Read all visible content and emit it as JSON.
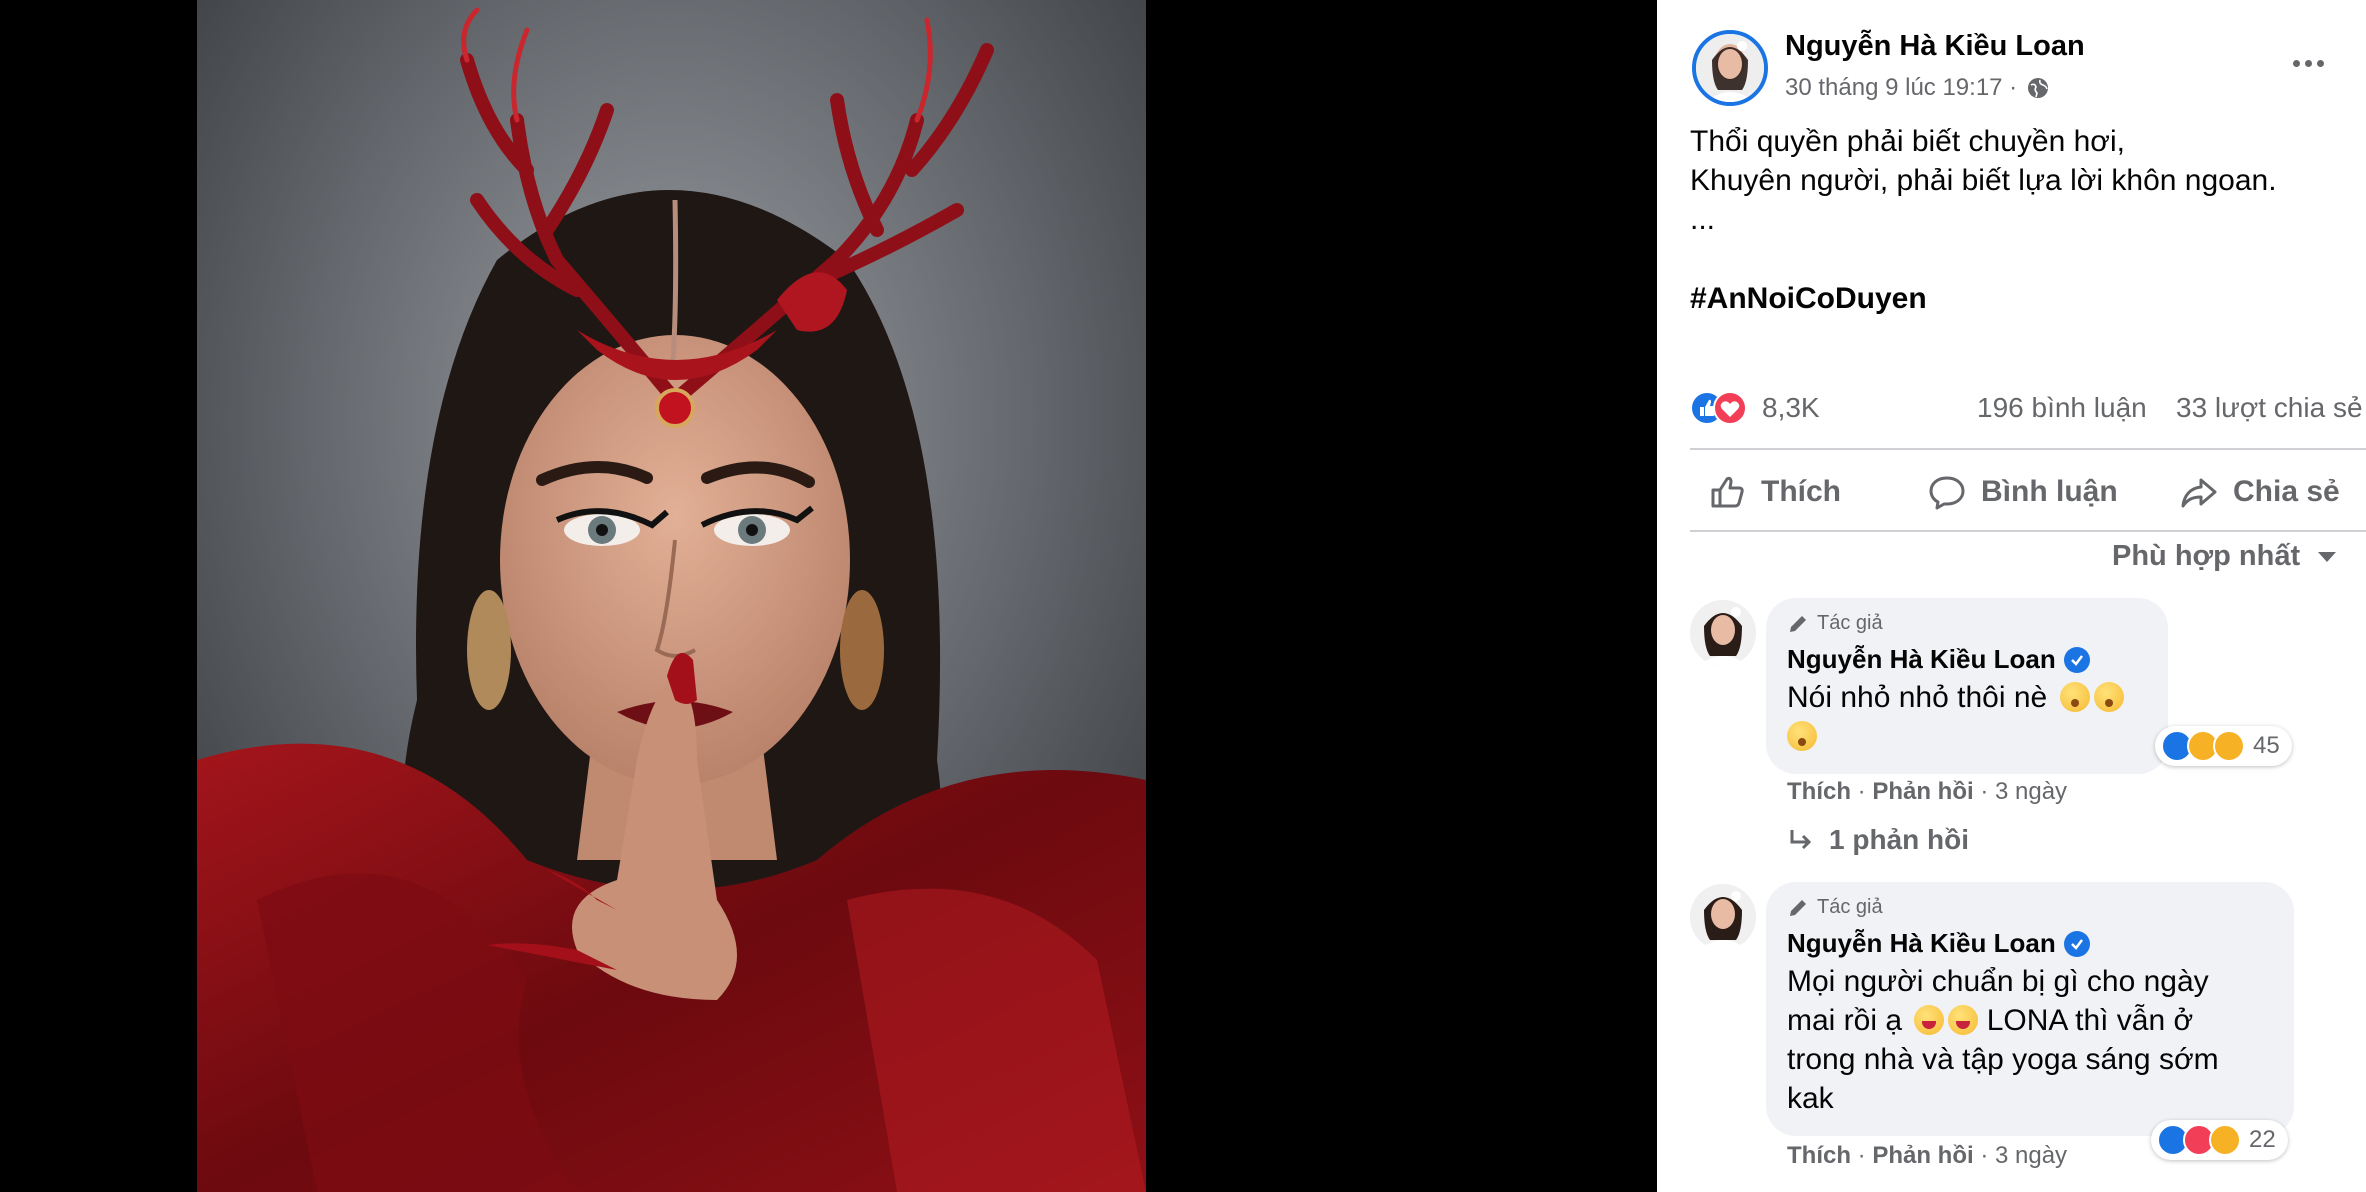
{
  "post": {
    "author": "Nguyễn Hà Kiều Loan",
    "timestamp": "30 tháng 9 lúc 19:17 ·",
    "text_lines": [
      "Thổi quyền phải biết chuyền hơi,",
      "Khuyên người, phải biết lựa lời khôn ngoan.",
      "..."
    ],
    "hashtag": "#AnNoiCoDuyen",
    "reaction_count": "8,3K",
    "comment_count": "196 bình luận",
    "share_count": "33 lượt chia sẻ"
  },
  "actions": {
    "like": "Thích",
    "comment": "Bình luận",
    "share": "Chia sẻ"
  },
  "sort_label": "Phù hợp nhất",
  "comments": [
    {
      "tag": "Tác giả",
      "author": "Nguyễn Hà Kiều Loan",
      "text_line1": "Nói nhỏ nhỏ thôi nè",
      "reaction_count": "45",
      "like_label": "Thích",
      "reply_label": "Phản hồi",
      "time": "3 ngày",
      "replies_label": "1 phản hồi"
    },
    {
      "tag": "Tác giả",
      "author": "Nguyễn Hà Kiều Loan",
      "text_line1": "Mọi người chuẩn bị gì cho ngày",
      "text_line2a": "mai rồi ạ",
      "text_line2b": "LONA thì vẫn ở",
      "text_line3": "trong nhà và tập yoga sáng sớm",
      "text_line4": "kak",
      "reaction_count": "22",
      "like_label": "Thích",
      "reply_label": "Phản hồi",
      "time": "3 ngày"
    }
  ],
  "colors": {
    "accent": "#1b74e4",
    "love": "#f33e58",
    "haha": "#f7b125",
    "secondary_text": "#65676b",
    "bubble": "#f0f2f5"
  },
  "icons": [
    "globe-icon",
    "more-icon",
    "like-icon",
    "love-icon",
    "comment-icon",
    "share-icon",
    "caret-down-icon",
    "pencil-icon",
    "verified-icon",
    "reply-arrow-icon"
  ]
}
